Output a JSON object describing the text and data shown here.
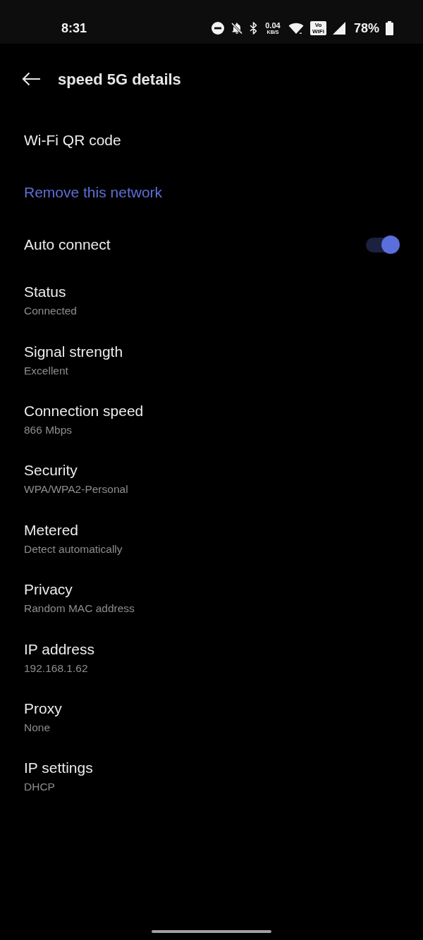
{
  "status_bar": {
    "time": "8:31",
    "net_speed": {
      "value": "0.04",
      "unit": "KB/S"
    },
    "vowifi": {
      "line_1": "Vo",
      "line_2": "WiFi"
    },
    "battery": "78%"
  },
  "header": {
    "title": "speed 5G details"
  },
  "actions": [
    {
      "kind": "plain",
      "label": "Wi-Fi QR code"
    },
    {
      "kind": "link",
      "label": "Remove this network"
    },
    {
      "kind": "toggle",
      "label": "Auto connect",
      "on": true
    }
  ],
  "details": [
    {
      "title": "Status",
      "value": "Connected"
    },
    {
      "title": "Signal strength",
      "value": "Excellent"
    },
    {
      "title": "Connection speed",
      "value": "866 Mbps"
    },
    {
      "title": "Security",
      "value": "WPA/WPA2-Personal"
    },
    {
      "title": "Metered",
      "value": "Detect automatically"
    },
    {
      "title": "Privacy",
      "value": "Random MAC address"
    },
    {
      "title": "IP address",
      "value": "192.168.1.62"
    },
    {
      "title": "Proxy",
      "value": "None"
    },
    {
      "title": "IP settings",
      "value": "DHCP"
    }
  ]
}
